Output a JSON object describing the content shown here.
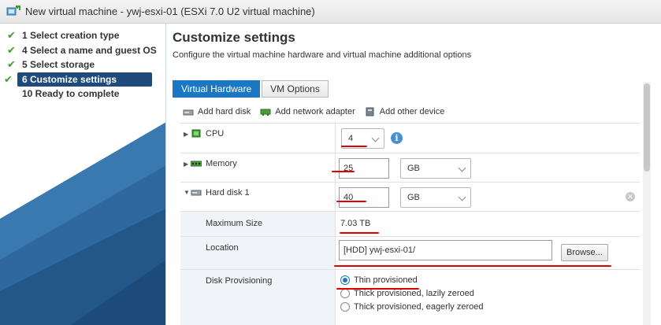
{
  "window": {
    "title": "New virtual machine - ywj-esxi-01 (ESXi 7.0 U2 virtual machine)"
  },
  "wizard": {
    "steps": [
      {
        "label": "1  Select creation type",
        "done": true
      },
      {
        "label": "4  Select a name and guest OS",
        "done": true
      },
      {
        "label": "5  Select storage",
        "done": true
      },
      {
        "label": "6  Customize settings",
        "done": true,
        "active": true
      },
      {
        "label": "10  Ready to complete",
        "done": false
      }
    ]
  },
  "main": {
    "title": "Customize settings",
    "subtitle": "Configure the virtual machine hardware and virtual machine additional options",
    "tabs": [
      {
        "label": "Virtual Hardware",
        "active": true
      },
      {
        "label": "VM Options",
        "active": false
      }
    ],
    "actions": [
      {
        "label": "Add hard disk",
        "icon": "hard-disk-icon"
      },
      {
        "label": "Add network adapter",
        "icon": "network-adapter-icon"
      },
      {
        "label": "Add other device",
        "icon": "device-icon"
      }
    ],
    "hardware": {
      "cpu": {
        "label": "CPU",
        "value": "4"
      },
      "memory": {
        "label": "Memory",
        "value": "25",
        "unit": "GB"
      },
      "hard_disk": {
        "label": "Hard disk 1",
        "value": "40",
        "unit": "GB"
      },
      "max_size": {
        "label": "Maximum Size",
        "value": "7.03 TB"
      },
      "location": {
        "label": "Location",
        "value": "[HDD] ywj-esxi-01/",
        "browse_label": "Browse..."
      },
      "provisioning": {
        "label": "Disk Provisioning",
        "options": [
          {
            "label": "Thin provisioned",
            "checked": true
          },
          {
            "label": "Thick provisioned, lazily zeroed",
            "checked": false
          },
          {
            "label": "Thick provisioned, eagerly zeroed",
            "checked": false
          }
        ]
      }
    }
  },
  "colors": {
    "accent": "#1b77c2",
    "active_step": "#1e4b7c",
    "check": "#3c9d2c",
    "annotation": "#e00000"
  }
}
